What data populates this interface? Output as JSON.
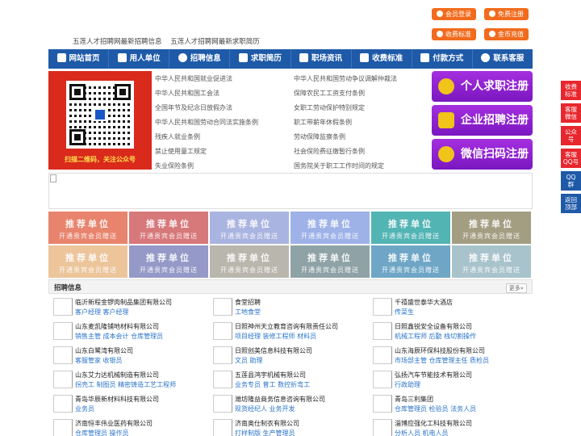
{
  "top_links": [
    "五莲人才招聘网最新招聘信息",
    "五莲人才招聘网最新求职简历"
  ],
  "top_buttons": [
    "会员登录",
    "免费注册",
    "收费标准",
    "金币充值"
  ],
  "nav": [
    "网站首页",
    "用人单位",
    "招聘信息",
    "求职简历",
    "职场资讯",
    "收费标准",
    "付款方式",
    "联系客服"
  ],
  "qr_caption": "扫描二维码，关注公众号",
  "laws_left": [
    "中华人民共和国就业促进法",
    "中华人民共和国工会法",
    "全国年节及纪念日放假办法",
    "中华人民共和国劳动合同法实施条例",
    "残疾人就业条例",
    "禁止使用童工规定",
    "失业保险条例"
  ],
  "laws_right": [
    "中华人民共和国劳动争议调解仲裁法",
    "保障农民工工资支付条例",
    "女职工劳动保护特别规定",
    "职工带薪年休假条例",
    "劳动保障监察条例",
    "社会保险费征缴暂行条例",
    "国务院关于职工工作时间的规定"
  ],
  "register_buttons": [
    "个人求职注册",
    "企业招聘注册",
    "微信扫码注册"
  ],
  "tile_title": "推荐单位",
  "tile_subtitle": "开通贵宾会员赠送",
  "tile_colors": [
    "#e8846d",
    "#d7787a",
    "#aab4e0",
    "#9eb2e8",
    "#53b4b4",
    "#a39d82",
    "#ecc59b",
    "#9599c7",
    "#b9b6ad",
    "#8fa3a6",
    "#6fa6c6",
    "#a8c3cc"
  ],
  "jobs_title": "招聘信息",
  "jobs_more": "更多»",
  "jobs": [
    {
      "company": "临沂新程金锣肉制品集团有限公司",
      "positions": "客户经理 客户经理"
    },
    {
      "company": "食堂招聘",
      "positions": "工地食堂"
    },
    {
      "company": "千禧盛世泰华大酒店",
      "positions": "传菜生"
    },
    {
      "company": "山东麦凯隆铺地材料有限公司",
      "positions": "销售主管 成本会计 仓库管理员"
    },
    {
      "company": "日照神州天立教育咨询有限责任公司",
      "positions": "项目经理 装修工程师 材料员"
    },
    {
      "company": "日照鑫锐安全设备有限公司",
      "positions": "机械工程师 后勤 栈切割操作"
    },
    {
      "company": "山东白鹭湾有限公司",
      "positions": "客服管家 收银员"
    },
    {
      "company": "日照创美信息科技有限公司",
      "positions": "文员 助理"
    },
    {
      "company": "山东海辰环保科技股份有限公司",
      "positions": "市场部主管 仓库管理主任 质检员"
    },
    {
      "company": "山东艾力达机械制造有限公司",
      "positions": "拐壳工 制图员 精密铸造工艺工程师"
    },
    {
      "company": "五莲县鸿宇机械有限公司",
      "positions": "业务专员 普工 数控折弯工"
    },
    {
      "company": "弘扬汽车节能技术有限公司",
      "positions": "行政助理"
    },
    {
      "company": "青岛华辰新材料科技有限公司",
      "positions": "业务员"
    },
    {
      "company": "潍坊隆益商务信息咨询有限公司",
      "positions": "现货经纪人 业务开发"
    },
    {
      "company": "青岛三利集团",
      "positions": "仓库管理员 检验员 法务人员"
    },
    {
      "company": "济南恒丰伟业医药有限公司",
      "positions": "仓库管理员 操作员"
    },
    {
      "company": "济南奥仕制衣有限公司",
      "positions": "打样制版 生产管理员"
    },
    {
      "company": "淄博应强化工科技有限公司",
      "positions": "分析人员 机电人员"
    }
  ],
  "side_buttons": [
    "收费\n标准",
    "客服\n微信",
    "公众\n号",
    "客服\nQQ号",
    "QQ\n群",
    "返回\n顶部"
  ],
  "colors": {
    "nav": "#1e5aa8",
    "accent": "#f26b1d",
    "register": "#8a20d0",
    "side": "#e8262d"
  }
}
